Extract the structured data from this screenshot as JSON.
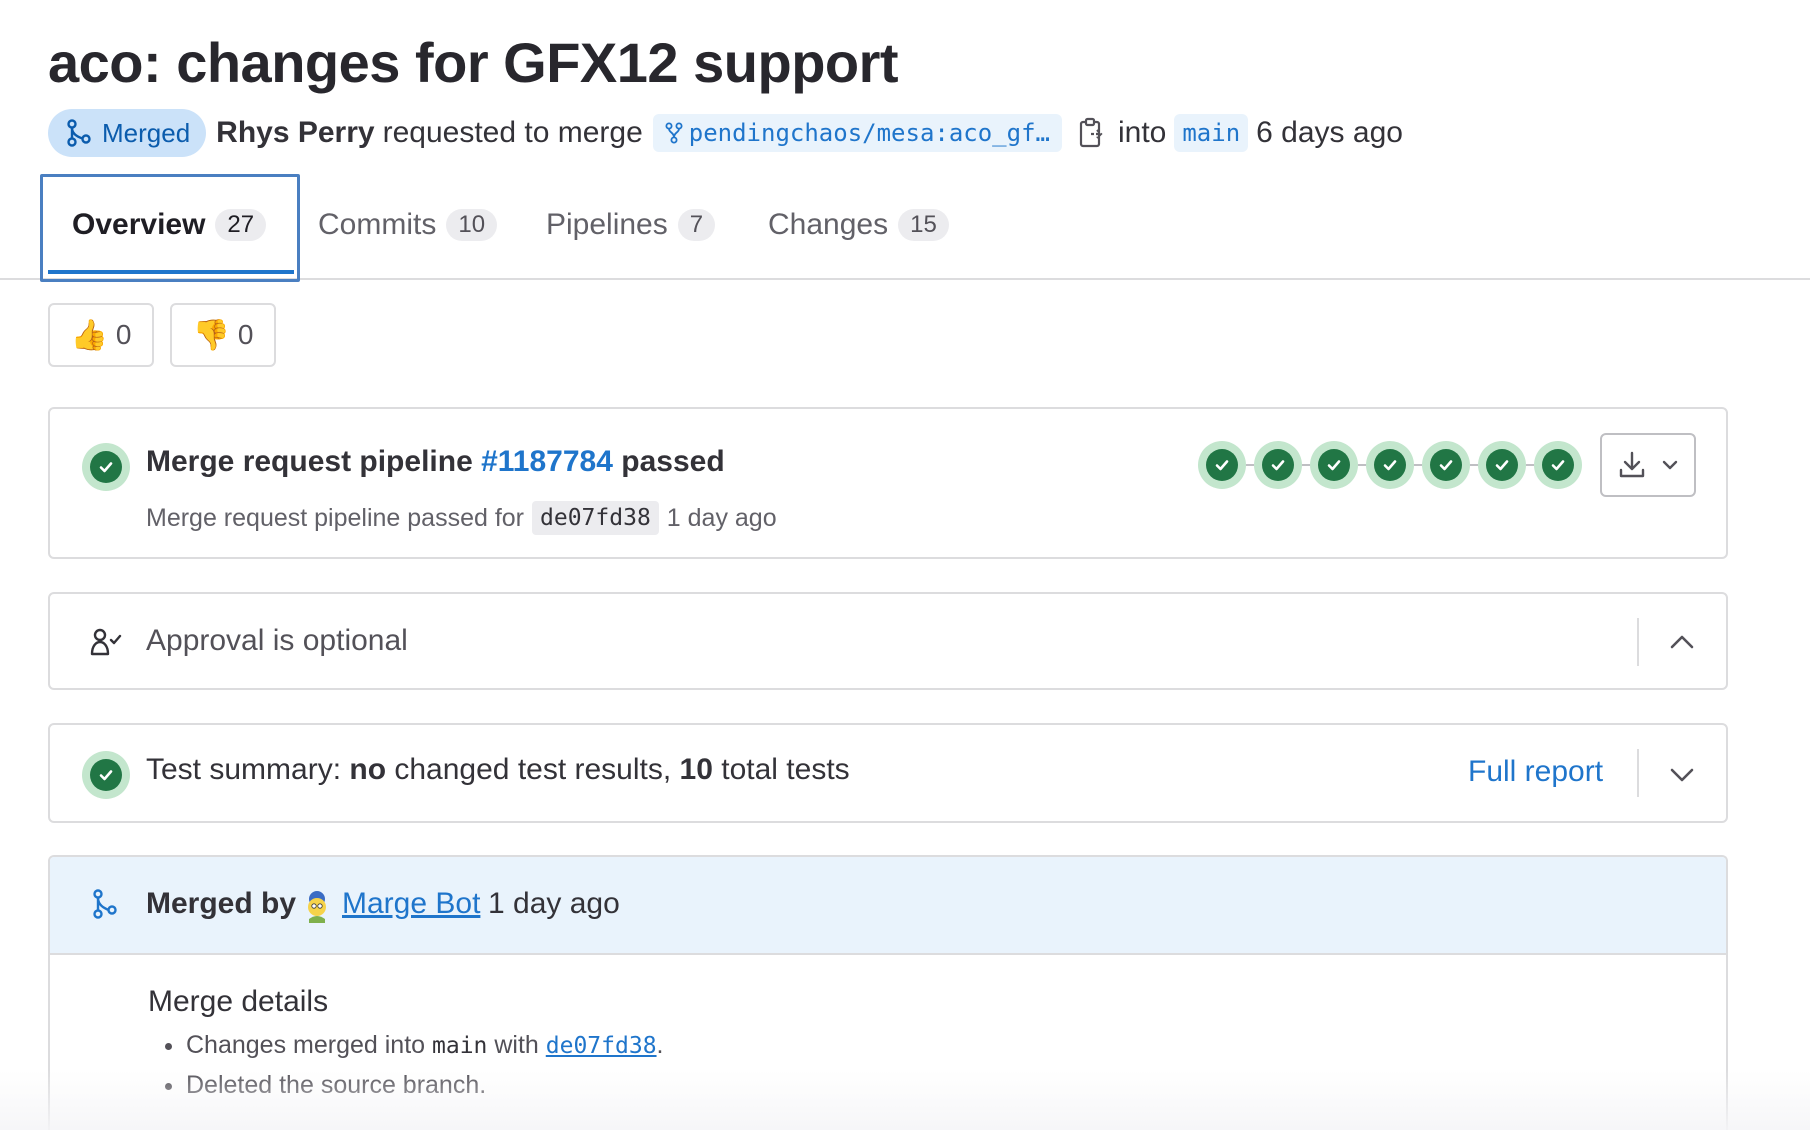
{
  "page_title": "aco: changes for GFX12 support",
  "meta": {
    "status_label": "Merged",
    "author": "Rhys Perry",
    "action_text": "requested to merge",
    "source_branch": "pendingchaos/mesa:aco_gf…",
    "into_text": "into",
    "target_branch": "main",
    "time": "6 days ago"
  },
  "tabs": [
    {
      "label": "Overview",
      "count": "27"
    },
    {
      "label": "Commits",
      "count": "10"
    },
    {
      "label": "Pipelines",
      "count": "7"
    },
    {
      "label": "Changes",
      "count": "15"
    }
  ],
  "reactions": {
    "thumbs_up": {
      "emoji": "👍",
      "count": "0"
    },
    "thumbs_down": {
      "emoji": "👎",
      "count": "0"
    }
  },
  "pipeline": {
    "title_prefix": "Merge request pipeline",
    "id": "#1187784",
    "title_suffix": "passed",
    "sub_text": "Merge request pipeline passed for",
    "sha": "de07fd38",
    "time": "1 day ago",
    "stage_count": 7,
    "stage_status": "success"
  },
  "approval": {
    "text": "Approval is optional"
  },
  "test_summary": {
    "prefix": "Test summary:",
    "changed": "no",
    "middle": "changed test results,",
    "total": "10",
    "suffix": "total tests",
    "link": "Full report"
  },
  "merged": {
    "label": "Merged by",
    "user": "Marge Bot",
    "time": "1 day ago",
    "details_title": "Merge details",
    "detail_1_prefix": "Changes merged into",
    "detail_1_branch": "main",
    "detail_1_mid": "with",
    "detail_1_sha": "de07fd38",
    "detail_1_end": ".",
    "detail_2": "Deleted the source branch."
  },
  "colors": {
    "link": "#1f75cb",
    "success": "#217645",
    "merged_badge_bg": "#cbe2f9",
    "merged_header_bg": "#e9f3fc"
  }
}
